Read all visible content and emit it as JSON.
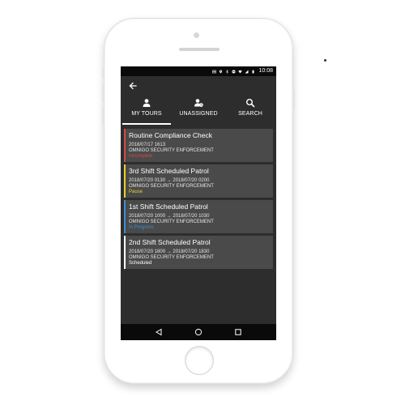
{
  "status_bar": {
    "time": "10:08",
    "icons": [
      "notification-icon",
      "location-icon",
      "bluetooth-icon",
      "do-not-disturb-icon",
      "wifi-icon",
      "signal-icon",
      "battery-icon"
    ]
  },
  "tabs": [
    {
      "label": "MY TOURS",
      "icon": "person-icon",
      "active": true
    },
    {
      "label": "UNASSIGNED",
      "icon": "person-question-icon",
      "active": false
    },
    {
      "label": "SEARCH",
      "icon": "search-icon",
      "active": false
    }
  ],
  "tours": [
    {
      "title": "Routine Compliance Check",
      "date": "2018/07/17 1613",
      "org": "OMNIGO SECURITY ENFORCEMENT",
      "status": "Incomplete",
      "status_color": "#d34a4a"
    },
    {
      "title": "3rd Shift Scheduled Patrol",
      "date": "2018/07/20 0130 → 2018/07/20 0200",
      "org": "OMNIGO SECURITY ENFORCEMENT",
      "status": "Pause",
      "status_color": "#e7d02b"
    },
    {
      "title": "1st Shift Scheduled Patrol",
      "date": "2018/07/20 1000 → 2018/07/20 1030",
      "org": "OMNIGO SECURITY ENFORCEMENT",
      "status": "In Progress",
      "status_color": "#3b8ed6"
    },
    {
      "title": "2nd Shift Scheduled Patrol",
      "date": "2018/07/20 1800 → 2018/07/20 1830",
      "org": "OMNIGO SECURITY ENFORCEMENT",
      "status": "Scheduled",
      "status_color": "#ffffff"
    }
  ],
  "colors": {
    "screen_bg": "#2d2d2d",
    "card_bg": "#4a4a4a",
    "bar_bg": "#0a0a0a"
  }
}
